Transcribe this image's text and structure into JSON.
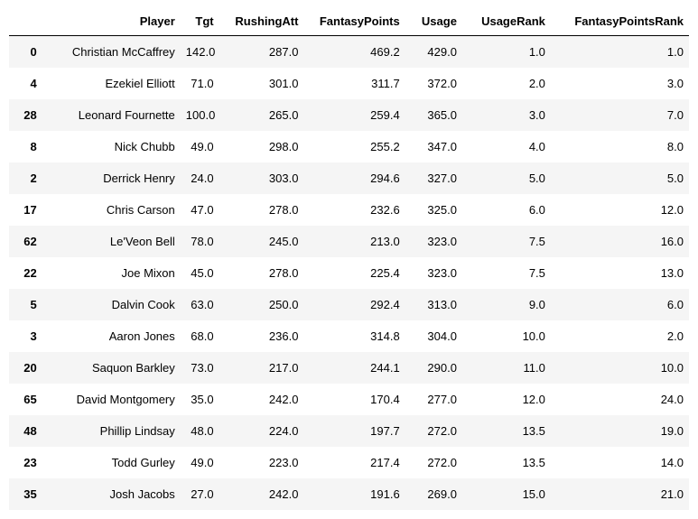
{
  "columns": {
    "index": "",
    "player": "Player",
    "tgt": "Tgt",
    "rushingAtt": "RushingAtt",
    "fantasyPoints": "FantasyPoints",
    "usage": "Usage",
    "usageRank": "UsageRank",
    "fantasyPointsRank": "FantasyPointsRank"
  },
  "rows": [
    {
      "idx": "0",
      "player": "Christian McCaffrey",
      "tgt": "142.0",
      "rushingAtt": "287.0",
      "fantasyPoints": "469.2",
      "usage": "429.0",
      "usageRank": "1.0",
      "fantasyPointsRank": "1.0"
    },
    {
      "idx": "4",
      "player": "Ezekiel Elliott",
      "tgt": "71.0",
      "rushingAtt": "301.0",
      "fantasyPoints": "311.7",
      "usage": "372.0",
      "usageRank": "2.0",
      "fantasyPointsRank": "3.0"
    },
    {
      "idx": "28",
      "player": "Leonard Fournette",
      "tgt": "100.0",
      "rushingAtt": "265.0",
      "fantasyPoints": "259.4",
      "usage": "365.0",
      "usageRank": "3.0",
      "fantasyPointsRank": "7.0"
    },
    {
      "idx": "8",
      "player": "Nick Chubb",
      "tgt": "49.0",
      "rushingAtt": "298.0",
      "fantasyPoints": "255.2",
      "usage": "347.0",
      "usageRank": "4.0",
      "fantasyPointsRank": "8.0"
    },
    {
      "idx": "2",
      "player": "Derrick Henry",
      "tgt": "24.0",
      "rushingAtt": "303.0",
      "fantasyPoints": "294.6",
      "usage": "327.0",
      "usageRank": "5.0",
      "fantasyPointsRank": "5.0"
    },
    {
      "idx": "17",
      "player": "Chris Carson",
      "tgt": "47.0",
      "rushingAtt": "278.0",
      "fantasyPoints": "232.6",
      "usage": "325.0",
      "usageRank": "6.0",
      "fantasyPointsRank": "12.0"
    },
    {
      "idx": "62",
      "player": "Le'Veon Bell",
      "tgt": "78.0",
      "rushingAtt": "245.0",
      "fantasyPoints": "213.0",
      "usage": "323.0",
      "usageRank": "7.5",
      "fantasyPointsRank": "16.0"
    },
    {
      "idx": "22",
      "player": "Joe Mixon",
      "tgt": "45.0",
      "rushingAtt": "278.0",
      "fantasyPoints": "225.4",
      "usage": "323.0",
      "usageRank": "7.5",
      "fantasyPointsRank": "13.0"
    },
    {
      "idx": "5",
      "player": "Dalvin Cook",
      "tgt": "63.0",
      "rushingAtt": "250.0",
      "fantasyPoints": "292.4",
      "usage": "313.0",
      "usageRank": "9.0",
      "fantasyPointsRank": "6.0"
    },
    {
      "idx": "3",
      "player": "Aaron Jones",
      "tgt": "68.0",
      "rushingAtt": "236.0",
      "fantasyPoints": "314.8",
      "usage": "304.0",
      "usageRank": "10.0",
      "fantasyPointsRank": "2.0"
    },
    {
      "idx": "20",
      "player": "Saquon Barkley",
      "tgt": "73.0",
      "rushingAtt": "217.0",
      "fantasyPoints": "244.1",
      "usage": "290.0",
      "usageRank": "11.0",
      "fantasyPointsRank": "10.0"
    },
    {
      "idx": "65",
      "player": "David Montgomery",
      "tgt": "35.0",
      "rushingAtt": "242.0",
      "fantasyPoints": "170.4",
      "usage": "277.0",
      "usageRank": "12.0",
      "fantasyPointsRank": "24.0"
    },
    {
      "idx": "48",
      "player": "Phillip Lindsay",
      "tgt": "48.0",
      "rushingAtt": "224.0",
      "fantasyPoints": "197.7",
      "usage": "272.0",
      "usageRank": "13.5",
      "fantasyPointsRank": "19.0"
    },
    {
      "idx": "23",
      "player": "Todd Gurley",
      "tgt": "49.0",
      "rushingAtt": "223.0",
      "fantasyPoints": "217.4",
      "usage": "272.0",
      "usageRank": "13.5",
      "fantasyPointsRank": "14.0"
    },
    {
      "idx": "35",
      "player": "Josh Jacobs",
      "tgt": "27.0",
      "rushingAtt": "242.0",
      "fantasyPoints": "191.6",
      "usage": "269.0",
      "usageRank": "15.0",
      "fantasyPointsRank": "21.0"
    }
  ]
}
